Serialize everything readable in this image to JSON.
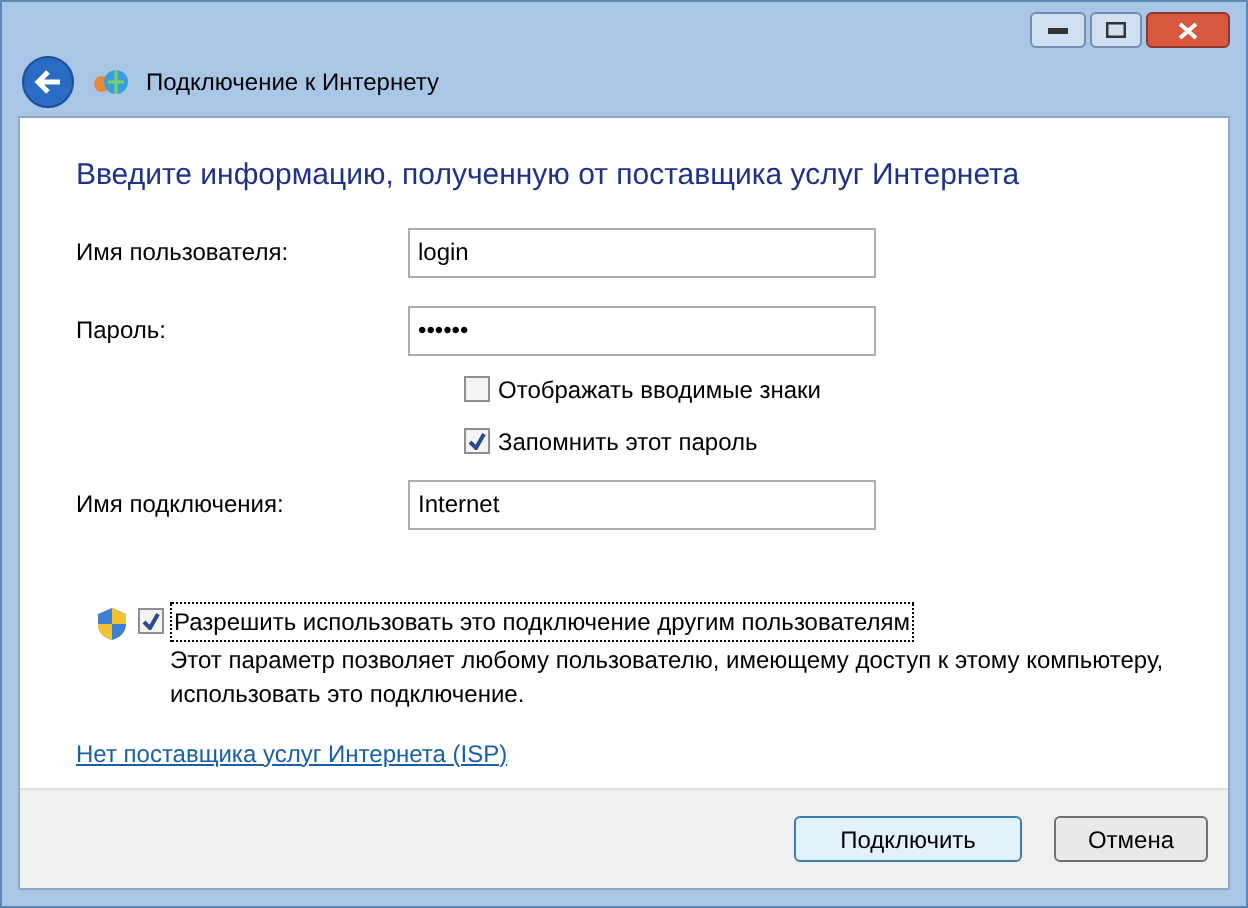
{
  "window": {
    "title": "Подключение к Интернету"
  },
  "heading": "Введите информацию, полученную от поставщика услуг Интернета",
  "fields": [
    {
      "label": "Имя пользователя:",
      "value": "login"
    },
    {
      "label": "Пароль:",
      "value": "••••••"
    }
  ],
  "password_options": [
    {
      "label": "Отображать вводимые знаки",
      "checked": false
    },
    {
      "label": "Запомнить этот пароль",
      "checked": true
    }
  ],
  "connection_name": {
    "label": "Имя подключения:",
    "value": "Internet"
  },
  "share": {
    "label": "Разрешить использовать это подключение другим пользователям",
    "checked": true,
    "description": "Этот параметр позволяет любому пользователю, имеющему доступ к этому компьютеру, использовать это подключение."
  },
  "link": "Нет поставщика услуг Интернета (ISP)",
  "buttons": [
    {
      "label": "Подключить",
      "default": true
    },
    {
      "label": "Отмена",
      "default": false
    }
  ]
}
